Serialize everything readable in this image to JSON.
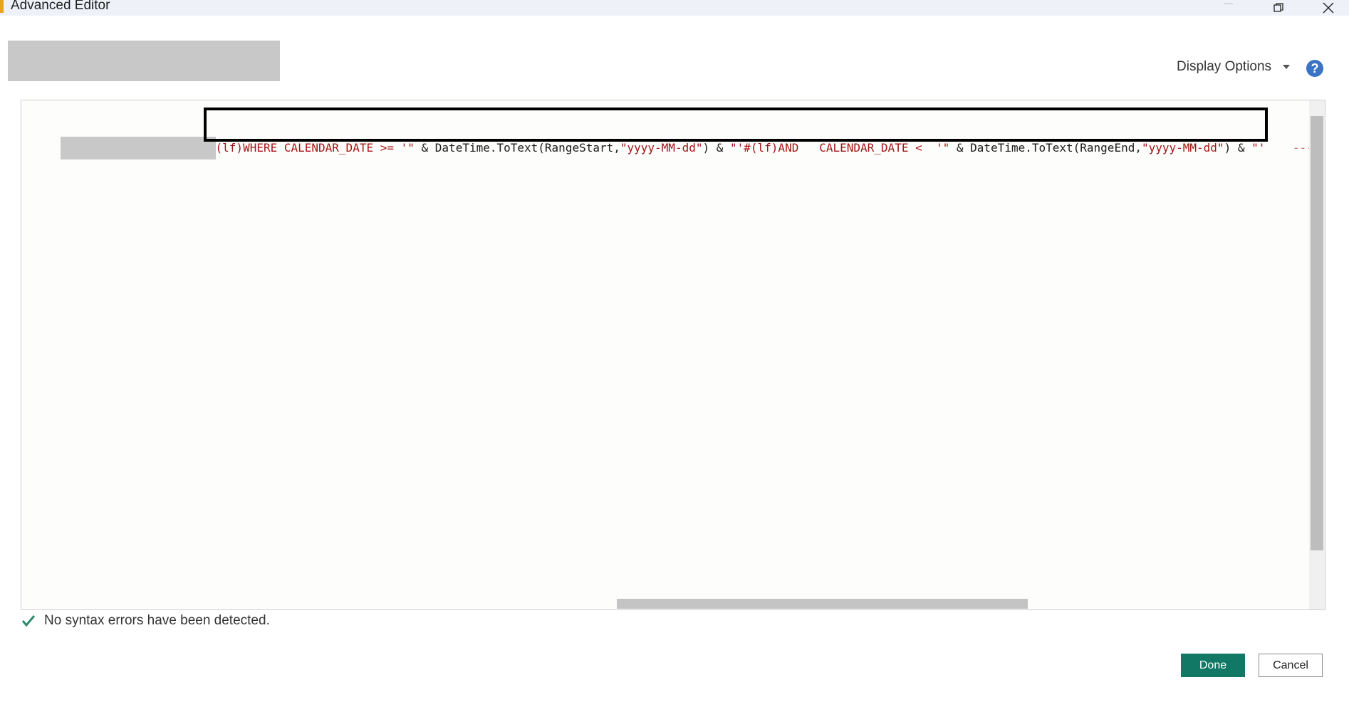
{
  "window": {
    "title": "Advanced Editor",
    "controls": [
      "minimize-icon",
      "restore-icon",
      "close-icon"
    ]
  },
  "header": {
    "display_options_label": "Display Options",
    "help_icon": "question-mark-icon",
    "help_glyph": "?"
  },
  "editor": {
    "code_tokens": [
      {
        "text": "(lf)WHERE CALENDAR_DATE >= '\"",
        "kind": "string"
      },
      {
        "text": " & DateTime.ToText(RangeStart,",
        "kind": "text"
      },
      {
        "text": "\"yyyy-MM-dd\"",
        "kind": "string"
      },
      {
        "text": ") & ",
        "kind": "text"
      },
      {
        "text": "\"'#(lf)AND   CALENDAR_DATE <  '\"",
        "kind": "string"
      },
      {
        "text": " & DateTime.ToText(RangeEnd,",
        "kind": "text"
      },
      {
        "text": "\"yyyy-MM-dd\"",
        "kind": "string"
      },
      {
        "text": ") & ",
        "kind": "text"
      },
      {
        "text": "\"'",
        "kind": "string"
      },
      {
        "text": "    --- T",
        "kind": "comment"
      }
    ]
  },
  "status": {
    "icon": "checkmark-icon",
    "message": "No syntax errors have been detected."
  },
  "footer": {
    "done_label": "Done",
    "cancel_label": "Cancel"
  },
  "colors": {
    "done_button": "#117865",
    "string_token": "#a31515",
    "help_icon": "#3b74c4",
    "status_check": "#2e8b6a"
  }
}
